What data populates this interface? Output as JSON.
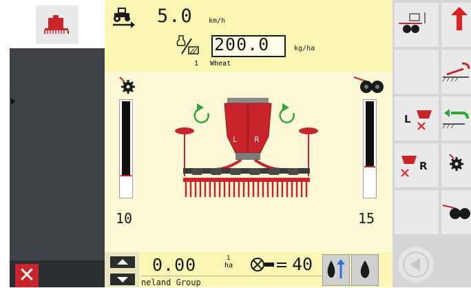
{
  "header": {
    "speed_value": "5.0",
    "speed_unit": "km/h",
    "rate_value": "200.0",
    "rate_unit": "kg/ha",
    "product_number": "1",
    "product_name": "Wheat"
  },
  "gauges": {
    "left_value": "10",
    "right_value": "15",
    "segment_left_label": "L",
    "segment_right_label": "R"
  },
  "hopper": {
    "left_label": "L",
    "right_label": "R"
  },
  "footer": {
    "area_value": "0.00",
    "area_unit_top": "1",
    "area_unit_bottom": "ha",
    "count_value": "40",
    "company_text": "neland Group"
  },
  "right_panel": {
    "section_left_label": "L",
    "section_right_label": "R"
  },
  "colors": {
    "accent_red": "#c9232b",
    "panel_yellow": "#fbf6b4",
    "panel_light": "#fdf9d6",
    "sidebar_dark": "#3e4247",
    "rotation_green": "#2fa83a"
  },
  "icons": [
    "implement-icon",
    "close-icon",
    "tractor-icon",
    "application-rate-icon",
    "sensor-gear-icon",
    "disc-icon",
    "rotate-icon",
    "scroll-up-icon",
    "scroll-down-icon",
    "area-counter-icon",
    "seed-flow-icon",
    "drop-icon",
    "lift-icon",
    "arrow-up-icon",
    "section-left-icon",
    "section-right-icon",
    "markers-icon",
    "hydraulic-icon",
    "back-arrow-icon"
  ]
}
